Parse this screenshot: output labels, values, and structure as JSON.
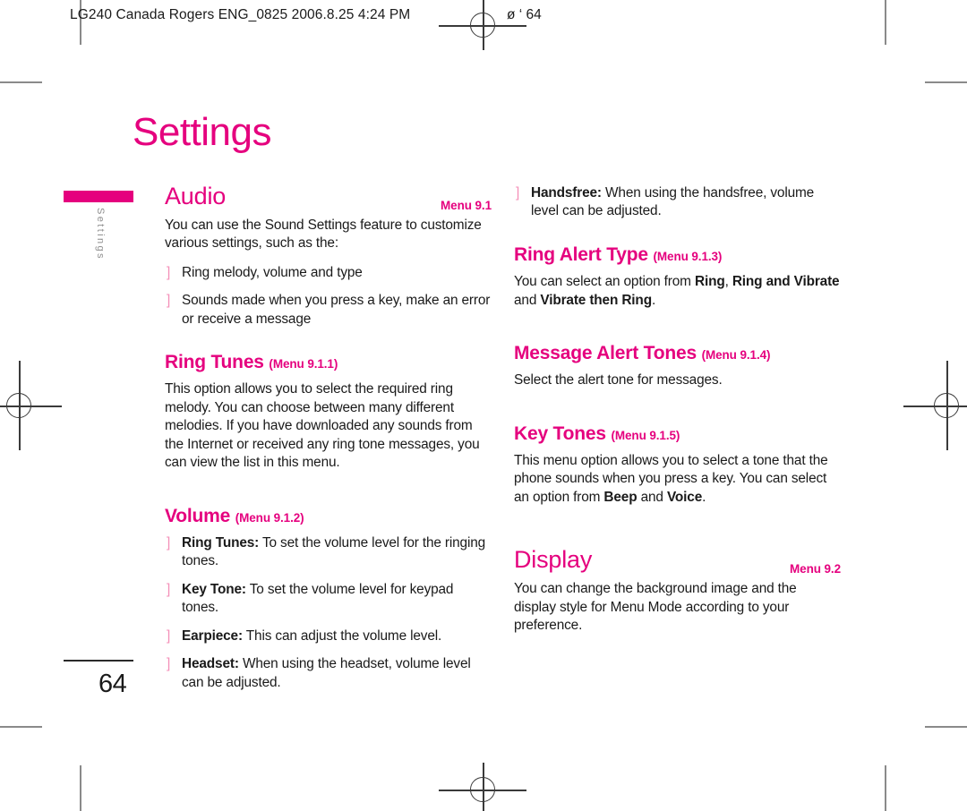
{
  "print_marks": {
    "header_slug": "LG240 Canada Rogers ENG_0825  2006.8.25 4:24 PM",
    "header_slug_right": "ø    ‘ 64"
  },
  "page": {
    "title": "Settings",
    "side_tab_label": "Settings",
    "folio": "64"
  },
  "left_column": {
    "audio": {
      "heading": "Audio",
      "menu": "Menu 9.1",
      "intro": "You can use the Sound Settings feature to customize various settings, such as the:",
      "bullets": [
        "Ring melody, volume and type",
        "Sounds made when you press a key, make an error or receive a message"
      ]
    },
    "ring_tunes": {
      "heading": "Ring Tunes",
      "menu": "(Menu 9.1.1)",
      "body": "This option allows you to select the required ring melody. You can choose between many different melodies. If you have downloaded any sounds from the Internet or received any ring tone messages, you can view the list in this menu."
    },
    "volume": {
      "heading": "Volume",
      "menu": "(Menu 9.1.2)",
      "bullets": [
        {
          "term": "Ring Tunes:",
          "text": " To set the volume level for the ringing tones."
        },
        {
          "term": "Key Tone:",
          "text": " To set the volume level for keypad tones."
        },
        {
          "term": "Earpiece:",
          "text": " This can adjust the volume level."
        },
        {
          "term": "Headset:",
          "text": " When using the headset, volume level can be adjusted."
        }
      ]
    }
  },
  "right_column": {
    "volume_continued": {
      "bullets": [
        {
          "term": "Handsfree:",
          "text": " When using the handsfree, volume level can be adjusted."
        }
      ]
    },
    "ring_alert_type": {
      "heading": "Ring Alert Type",
      "menu": "(Menu 9.1.3)",
      "body_pre": "You can select an option from ",
      "body_b1": "Ring",
      "body_mid1": ", ",
      "body_b2": "Ring and Vibrate",
      "body_mid2": " and ",
      "body_b3": "Vibrate then Ring",
      "body_end": "."
    },
    "message_alert_tones": {
      "heading": "Message Alert Tones",
      "menu": "(Menu 9.1.4)",
      "body": "Select the alert tone for messages."
    },
    "key_tones": {
      "heading": "Key Tones",
      "menu": "(Menu 9.1.5)",
      "body_pre": "This menu option allows you to select a tone that the phone sounds when you press a key. You can select an option from ",
      "body_b1": "Beep",
      "body_mid1": " and ",
      "body_b2": "Voice",
      "body_end": "."
    },
    "display": {
      "heading": "Display",
      "menu": "Menu 9.2",
      "body": "You can change the background image and the display style for Menu Mode according to your preference."
    }
  },
  "colors": {
    "accent_magenta": "#e5007e",
    "bullet_pink": "#f48fb8",
    "text": "#1a1a1a",
    "side_label_gray": "#8e8e8e",
    "crop_mark_gray": "#8a8a8a"
  },
  "bullet_glyph": "]"
}
